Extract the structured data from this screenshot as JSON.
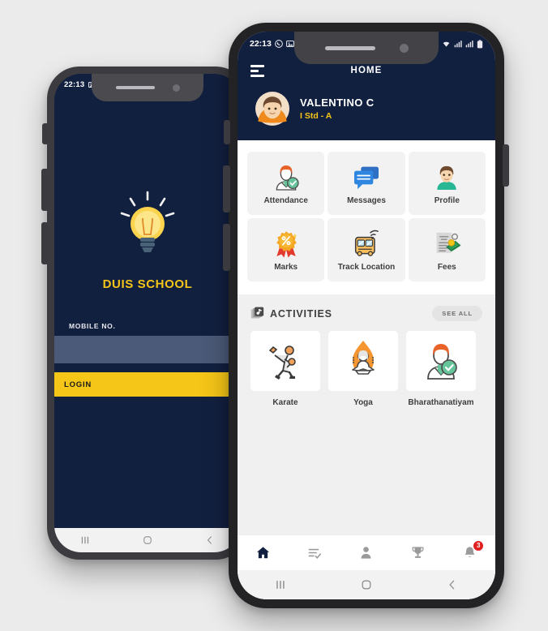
{
  "page": {
    "background": "#ebebeb",
    "navy": "#122040",
    "yellow": "#f5c518",
    "badge_red": "#e02020"
  },
  "login_phone": {
    "status_bar": {
      "time": "22:13",
      "icons": [
        "image-icon",
        "whatsapp-icon",
        "wifi-icon",
        "signal-icon",
        "battery-icon"
      ]
    },
    "logo_icon": "lightbulb-icon",
    "school_name": "DUIS SCHOOL",
    "mobile_label": "MOBILE NO.",
    "mobile_value": "",
    "mobile_placeholder": "",
    "login_label": "LOGIN",
    "system_nav": [
      "recents-icon",
      "home-icon",
      "back-icon"
    ]
  },
  "home_phone": {
    "status_bar": {
      "time": "22:13",
      "icons": [
        "whatsapp-icon",
        "gallery-icon",
        "alarm-icon",
        "wifi-icon",
        "signal-icon",
        "signal-icon",
        "battery-icon"
      ]
    },
    "appbar": {
      "menu_icon": "hamburger-menu-icon",
      "title": "HOME"
    },
    "profile": {
      "avatar_icon": "student-avatar-icon",
      "name": "VALENTINO C",
      "class": "I Std - A"
    },
    "tiles": [
      {
        "label": "Attendance",
        "icon": "attendance-teacher-check-icon"
      },
      {
        "label": "Messages",
        "icon": "chat-bubbles-icon"
      },
      {
        "label": "Profile",
        "icon": "person-profile-icon"
      },
      {
        "label": "Marks",
        "icon": "award-ribbon-percent-icon"
      },
      {
        "label": "Track Location",
        "icon": "school-bus-signal-icon"
      },
      {
        "label": "Fees",
        "icon": "document-money-icon"
      }
    ],
    "activities": {
      "icon": "activities-stack-icon",
      "title": "ACTIVITIES",
      "see_all_label": "SEE ALL",
      "items": [
        {
          "name": "Karate",
          "icon": "karate-kick-icon"
        },
        {
          "name": "Yoga",
          "icon": "yoga-lotus-icon"
        },
        {
          "name": "Bharathanatiyam",
          "icon": "dance-teacher-icon"
        }
      ]
    },
    "bottom_nav": [
      {
        "icon": "home-icon",
        "active": true,
        "badge": ""
      },
      {
        "icon": "tasks-check-icon",
        "active": false,
        "badge": ""
      },
      {
        "icon": "person-icon",
        "active": false,
        "badge": ""
      },
      {
        "icon": "trophy-icon",
        "active": false,
        "badge": ""
      },
      {
        "icon": "bell-notification-icon",
        "active": false,
        "badge": "3"
      }
    ],
    "system_nav": [
      "recents-icon",
      "home-icon",
      "back-icon"
    ]
  }
}
